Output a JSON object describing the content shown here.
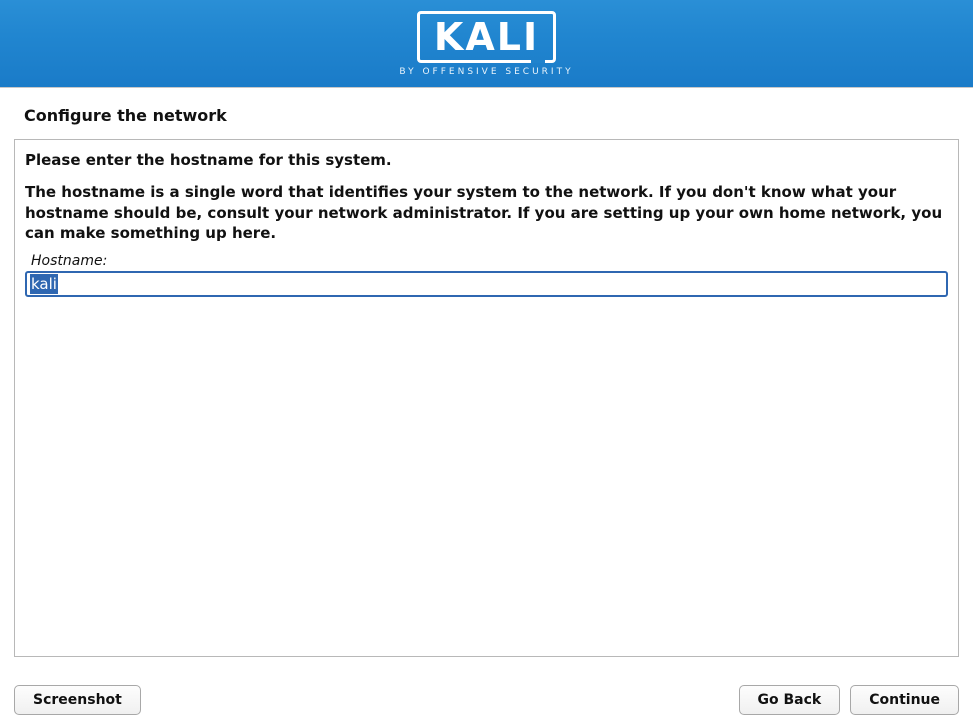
{
  "header": {
    "logo_text": "KALI",
    "logo_subtitle": "BY OFFENSIVE SECURITY"
  },
  "page": {
    "title": "Configure the network"
  },
  "form": {
    "prompt_heading": "Please enter the hostname for this system.",
    "prompt_description": "The hostname is a single word that identifies your system to the network. If you don't know what your hostname should be, consult your network administrator. If you are setting up your own home network, you can make something up here.",
    "hostname_label": "Hostname:",
    "hostname_value": "kali"
  },
  "buttons": {
    "screenshot": "Screenshot",
    "go_back": "Go Back",
    "continue": "Continue"
  }
}
